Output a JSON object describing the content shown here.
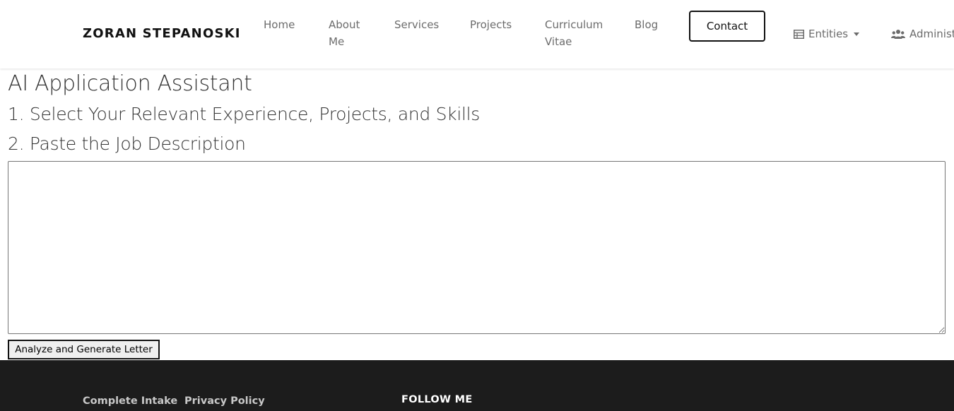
{
  "nav": {
    "brand": "ZORAN STEPANOSKI",
    "links": {
      "home": "Home",
      "about": "About Me",
      "services": "Services",
      "projects": "Projects",
      "cv": "Curriculum Vitae",
      "blog": "Blog"
    },
    "contact": "Contact",
    "entities": "Entities",
    "admin": "Administration"
  },
  "main": {
    "title": "AI Application Assistant",
    "step1": "1. Select Your Relevant Experience, Projects, and Skills",
    "step2": "2. Paste the Job Description",
    "textarea_value": "",
    "button": "Analyze and Generate Letter"
  },
  "footer": {
    "link1": "Complete Intake",
    "link2": "Privacy Policy",
    "follow": "FOLLOW ME"
  },
  "icons": {
    "entities": "table-icon",
    "admin": "users-icon"
  },
  "colors": {
    "footer_bg": "#1c1c1c",
    "nav_text": "#6c6c6c"
  }
}
